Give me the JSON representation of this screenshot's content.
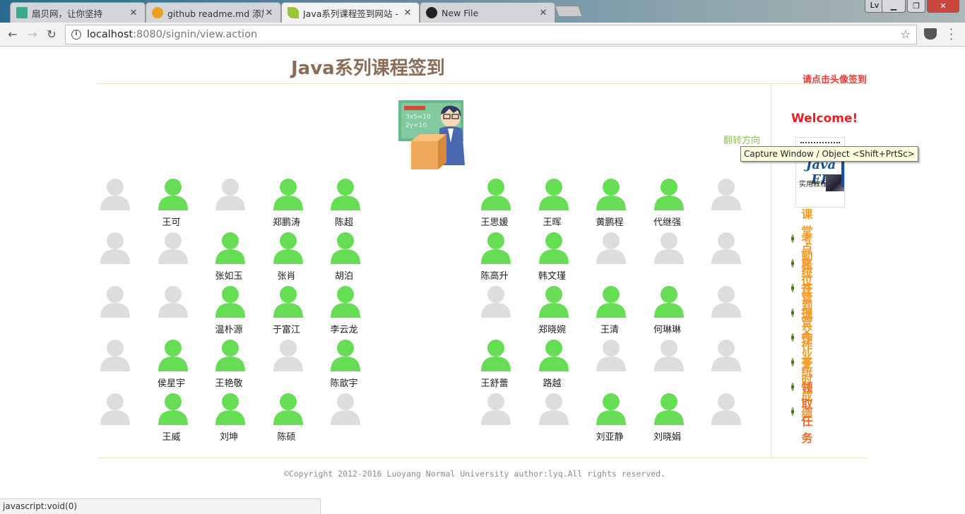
{
  "browser": {
    "tabs": [
      {
        "title": "扇贝网，让你坚持",
        "favicon_color": "#3aa98a"
      },
      {
        "title": "github readme.md 添加",
        "favicon_color": "#e8a020"
      },
      {
        "title": "Java系列课程签到网站 -",
        "favicon_color": "#9ac43a"
      },
      {
        "title": "New File",
        "favicon_color": "#222222"
      }
    ],
    "user_badge": "Lv",
    "url_host": "localhost",
    "url_path": ":8080/signin/view.action",
    "status_text": "javascript:void(0)"
  },
  "page": {
    "title": "Java系列课程签到",
    "hint": "请点击头像签到",
    "flip": "翻转方向",
    "tooltip": "Capture Window / Object <Shift+PrtSc>",
    "welcome": "Welcome!",
    "book": {
      "title": "Java EE",
      "subtitle": "实用教程"
    },
    "copyright": "©Copyright 2012-2016 Luoyang Normal University author:lyq.All rights reserved."
  },
  "colors": {
    "signed": "#66dd55",
    "empty": "#dddddd",
    "title": "#8a6d59",
    "menu": "#f39b2a",
    "welcome": "#e62020"
  },
  "seats": {
    "left": [
      [
        {
          "name": "",
          "signed": false
        },
        {
          "name": "王可",
          "signed": true
        },
        {
          "name": "",
          "signed": false
        },
        {
          "name": "郑鹏涛",
          "signed": true
        },
        {
          "name": "陈超",
          "signed": true
        }
      ],
      [
        {
          "name": "",
          "signed": false
        },
        {
          "name": "",
          "signed": false
        },
        {
          "name": "张如玉",
          "signed": true
        },
        {
          "name": "张肖",
          "signed": true
        },
        {
          "name": "胡泊",
          "signed": true
        }
      ],
      [
        {
          "name": "",
          "signed": false
        },
        {
          "name": "",
          "signed": false
        },
        {
          "name": "温朴源",
          "signed": true
        },
        {
          "name": "于富江",
          "signed": true
        },
        {
          "name": "李云龙",
          "signed": true
        }
      ],
      [
        {
          "name": "",
          "signed": false
        },
        {
          "name": "侯星宇",
          "signed": true
        },
        {
          "name": "王艳敬",
          "signed": true
        },
        {
          "name": "",
          "signed": false
        },
        {
          "name": "陈歆宇",
          "signed": true
        }
      ],
      [
        {
          "name": "",
          "signed": false
        },
        {
          "name": "王威",
          "signed": true
        },
        {
          "name": "刘坤",
          "signed": true
        },
        {
          "name": "陈硕",
          "signed": true
        },
        {
          "name": "",
          "signed": false
        }
      ]
    ],
    "right": [
      [
        {
          "name": "王思媛",
          "signed": true
        },
        {
          "name": "王晖",
          "signed": true
        },
        {
          "name": "黄鹏程",
          "signed": true
        },
        {
          "name": "代继强",
          "signed": true
        },
        {
          "name": "",
          "signed": false
        }
      ],
      [
        {
          "name": "陈高升",
          "signed": true
        },
        {
          "name": "韩文瑾",
          "signed": true
        },
        {
          "name": "",
          "signed": false
        },
        {
          "name": "",
          "signed": false
        },
        {
          "name": "",
          "signed": false
        }
      ],
      [
        {
          "name": "",
          "signed": false
        },
        {
          "name": "郑晓婉",
          "signed": true
        },
        {
          "name": "王清",
          "signed": true
        },
        {
          "name": "何琳琳",
          "signed": true
        },
        {
          "name": "",
          "signed": false
        }
      ],
      [
        {
          "name": "王舒蕾",
          "signed": true
        },
        {
          "name": "路越",
          "signed": true
        },
        {
          "name": "",
          "signed": false
        },
        {
          "name": "",
          "signed": false
        },
        {
          "name": "",
          "signed": false
        }
      ],
      [
        {
          "name": "",
          "signed": false
        },
        {
          "name": "",
          "signed": false
        },
        {
          "name": "刘亚静",
          "signed": true
        },
        {
          "name": "刘晓娟",
          "signed": true
        },
        {
          "name": "",
          "signed": false
        }
      ]
    ]
  },
  "menu": [
    "课堂点名",
    "考勤统计",
    "座位管理",
    "签到管理",
    "提交作业",
    "作业统计",
    "平时成绩",
    "领取任务"
  ]
}
